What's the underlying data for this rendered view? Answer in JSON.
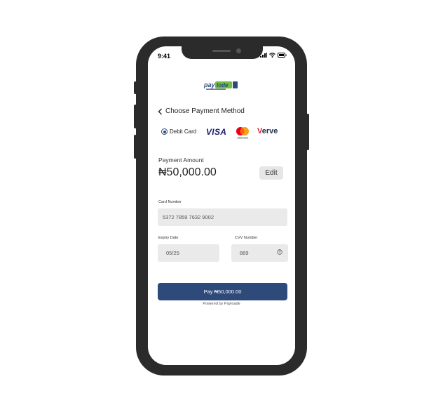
{
  "status_bar": {
    "time": "9:41"
  },
  "header": {
    "back_title": "Choose Payment Method"
  },
  "payment_methods": {
    "debit_label": "Debit Card",
    "visa_label": "VISA",
    "mastercard_label": "mastercard",
    "verve_v": "V",
    "verve_rest": "erve"
  },
  "payment": {
    "amount_label": "Payment Amount",
    "amount_value": "₦50,000.00",
    "edit_label": "Edit"
  },
  "form": {
    "card_number_label": "Card Number",
    "card_number_value": "5372 7859 7632 9002",
    "expiry_label": "Expiry Date",
    "expiry_value": "05/25",
    "cvv_label": "CVV Number",
    "cvv_value": "889"
  },
  "pay_button": {
    "label": "Pay ₦50,000.00"
  },
  "footer": {
    "powered_by": "Powered by Payloade"
  },
  "colors": {
    "primary": "#2e4a7a",
    "field_bg": "#eaeaea",
    "frame": "#2b2b2b"
  }
}
